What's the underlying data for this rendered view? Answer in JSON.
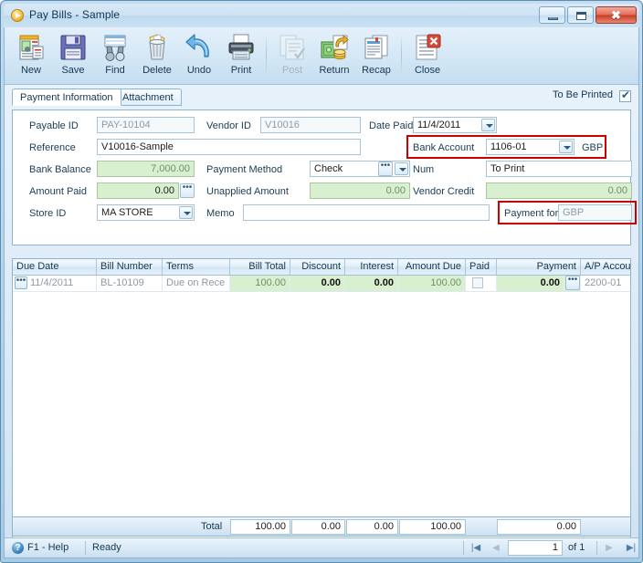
{
  "window": {
    "title": "Pay Bills - Sample",
    "minimize_label": "Minimize",
    "maximize_label": "Maximize",
    "close_label": "Close",
    "close_glyph": "✖",
    "accent_red": "#cc0000",
    "field_green": "#d9f0d0"
  },
  "toolbar": {
    "buttons": [
      {
        "label": "New",
        "icon": "new-document-icon",
        "enabled": true
      },
      {
        "label": "Save",
        "icon": "floppy-disk-icon",
        "enabled": true
      },
      {
        "label": "Find",
        "icon": "binoculars-icon",
        "enabled": true
      },
      {
        "label": "Delete",
        "icon": "trash-can-icon",
        "enabled": true
      },
      {
        "label": "Undo",
        "icon": "undo-arrow-icon",
        "enabled": true
      },
      {
        "label": "Print",
        "icon": "printer-icon",
        "enabled": true
      },
      {
        "label": "Post",
        "icon": "post-pages-icon",
        "enabled": false
      },
      {
        "label": "Return",
        "icon": "money-return-icon",
        "enabled": true
      },
      {
        "label": "Recap",
        "icon": "recap-report-icon",
        "enabled": true
      },
      {
        "label": "Close",
        "icon": "close-document-icon",
        "enabled": true
      }
    ]
  },
  "tabs": {
    "items": [
      {
        "label": "Payment Information",
        "active": true
      },
      {
        "label": "Attachment",
        "active": false
      }
    ],
    "to_be_printed_label": "To Be Printed",
    "to_be_printed_checked": true
  },
  "form": {
    "payable_id": {
      "label": "Payable ID",
      "value": "PAY-10104",
      "readonly": true
    },
    "vendor_id": {
      "label": "Vendor ID",
      "value": "V10016",
      "readonly": true
    },
    "date_paid": {
      "label": "Date Paid",
      "value": "11/4/2011"
    },
    "reference": {
      "label": "Reference",
      "value": "V10016-Sample"
    },
    "bank_account": {
      "label": "Bank Account",
      "value": "1106-01",
      "currency": "GBP",
      "highlighted": true
    },
    "bank_balance": {
      "label": "Bank Balance",
      "value": "7,000.00",
      "readonly": true
    },
    "payment_method": {
      "label": "Payment Method",
      "value": "Check"
    },
    "num": {
      "label": "Num",
      "value": "To Print"
    },
    "amount_paid": {
      "label": "Amount Paid",
      "value": "0.00"
    },
    "unapplied_amount": {
      "label": "Unapplied Amount",
      "value": "0.00",
      "readonly": true
    },
    "vendor_credit": {
      "label": "Vendor Credit",
      "value": "0.00",
      "readonly": true
    },
    "store_id": {
      "label": "Store ID",
      "value": "MA STORE"
    },
    "memo": {
      "label": "Memo",
      "value": ""
    },
    "payment_for": {
      "label": "Payment for",
      "value": "GBP",
      "readonly": true,
      "highlighted": true
    }
  },
  "grid": {
    "columns": [
      {
        "key": "due_date",
        "label": "Due Date",
        "align": "left"
      },
      {
        "key": "bill_number",
        "label": "Bill Number",
        "align": "left"
      },
      {
        "key": "terms",
        "label": "Terms",
        "align": "left"
      },
      {
        "key": "bill_total",
        "label": "Bill Total",
        "align": "right"
      },
      {
        "key": "discount",
        "label": "Discount",
        "align": "right"
      },
      {
        "key": "interest",
        "label": "Interest",
        "align": "right"
      },
      {
        "key": "amount_due",
        "label": "Amount Due",
        "align": "right"
      },
      {
        "key": "paid",
        "label": "Paid",
        "align": "left"
      },
      {
        "key": "payment",
        "label": "Payment",
        "align": "right"
      },
      {
        "key": "ap_account",
        "label": "A/P Account",
        "align": "left"
      }
    ],
    "rows": [
      {
        "due_date": "11/4/2011",
        "bill_number": "BL-10109",
        "terms": "Due on Rece",
        "bill_total": "100.00",
        "discount": "0.00",
        "interest": "0.00",
        "amount_due": "100.00",
        "paid": false,
        "payment": "0.00",
        "ap_account": "2200-01"
      }
    ]
  },
  "totals": {
    "label": "Total",
    "bill_total": "100.00",
    "discount": "0.00",
    "interest": "0.00",
    "amount_due": "100.00",
    "payment": "0.00"
  },
  "statusbar": {
    "help_glyph": "?",
    "help_label": "F1 - Help",
    "state": "Ready",
    "first_glyph": "|◀",
    "prev_glyph": "◀",
    "page": "1",
    "of_label": "of 1",
    "next_glyph": "▶",
    "last_glyph": "▶|"
  }
}
